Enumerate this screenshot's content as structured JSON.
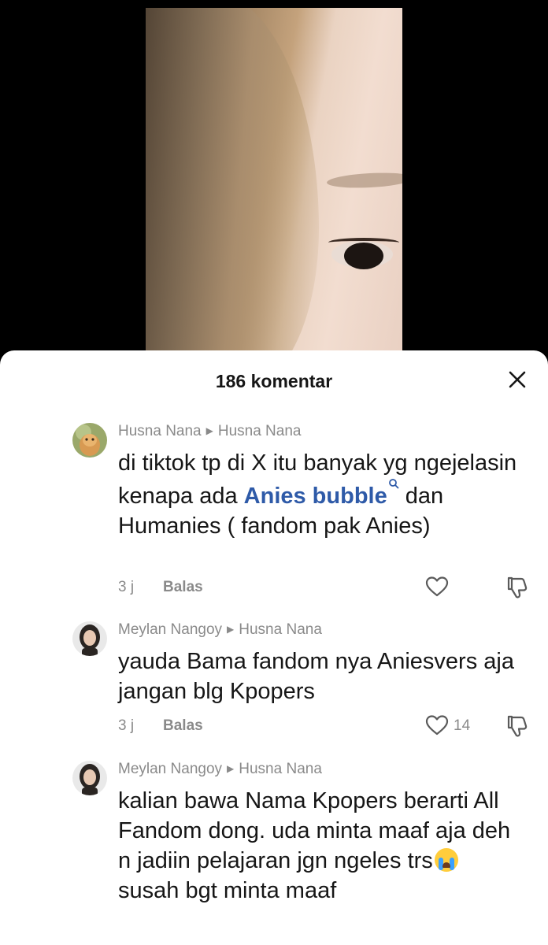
{
  "comments_panel": {
    "title": "186 komentar",
    "close_icon": "close-icon"
  },
  "comments": [
    {
      "author": "Husna Nana",
      "reply_to": "Husna Nana",
      "text_before": "di tiktok tp di X itu banyak yg ngejelasin kenapa ada ",
      "link_text": "Anies bubble",
      "text_after": " dan Humanies ( fandom pak Anies)",
      "time": "3 j",
      "reply_label": "Balas",
      "likes": ""
    },
    {
      "author": "Meylan Nangoy",
      "reply_to": "Husna Nana",
      "text": "yauda Bama fandom nya Aniesvers aja jangan blg Kpopers",
      "time": "3 j",
      "reply_label": "Balas",
      "likes": "14"
    },
    {
      "author": "Meylan Nangoy",
      "reply_to": "Husna Nana",
      "text_before": "kalian bawa Nama Kpopers berarti All Fandom dong. uda minta maaf aja deh n jadiin pelajaran jgn ngeles trs",
      "emoji": "loudly-crying-face",
      "text_after": " susah bgt minta maaf"
    }
  ],
  "colors": {
    "link": "#2e5aa8",
    "meta": "#8a8a8a",
    "text": "#161616"
  }
}
